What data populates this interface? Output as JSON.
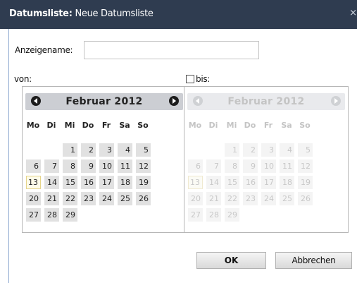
{
  "window": {
    "title_prefix": "Datumsliste:",
    "title_value": "Neue Datumsliste",
    "close_glyph": "×"
  },
  "form": {
    "display_name_label": "Anzeigename:",
    "display_name_value": "",
    "from_label": "von:",
    "to_label": "bis:",
    "to_checked": false
  },
  "calendar_from": {
    "month_label": "Februar 2012",
    "enabled": true,
    "weekdays": [
      "Mo",
      "Di",
      "Mi",
      "Do",
      "Fr",
      "Sa",
      "So"
    ],
    "first_weekday_index": 2,
    "days": [
      "1",
      "2",
      "3",
      "4",
      "5",
      "6",
      "7",
      "8",
      "9",
      "10",
      "11",
      "12",
      "13",
      "14",
      "15",
      "16",
      "17",
      "18",
      "19",
      "20",
      "21",
      "22",
      "23",
      "24",
      "25",
      "26",
      "27",
      "28",
      "29"
    ],
    "today": "13"
  },
  "calendar_to": {
    "month_label": "Februar 2012",
    "enabled": false,
    "weekdays": [
      "Mo",
      "Di",
      "Mi",
      "Do",
      "Fr",
      "Sa",
      "So"
    ],
    "first_weekday_index": 2,
    "days": [
      "1",
      "2",
      "3",
      "4",
      "5",
      "6",
      "7",
      "8",
      "9",
      "10",
      "11",
      "12",
      "13",
      "14",
      "15",
      "16",
      "17",
      "18",
      "19",
      "20",
      "21",
      "22",
      "23",
      "24",
      "25",
      "26",
      "27",
      "28",
      "29"
    ],
    "today": "13"
  },
  "buttons": {
    "ok_label": "OK",
    "cancel_label": "Abbrechen"
  },
  "icons": {
    "prev": "chevron-left-icon",
    "next": "chevron-right-icon",
    "close": "close-icon"
  },
  "colors": {
    "titlebar": "#2f3c50",
    "day_bg": "#e1e1e1",
    "today_bg": "#fdfbe9"
  }
}
